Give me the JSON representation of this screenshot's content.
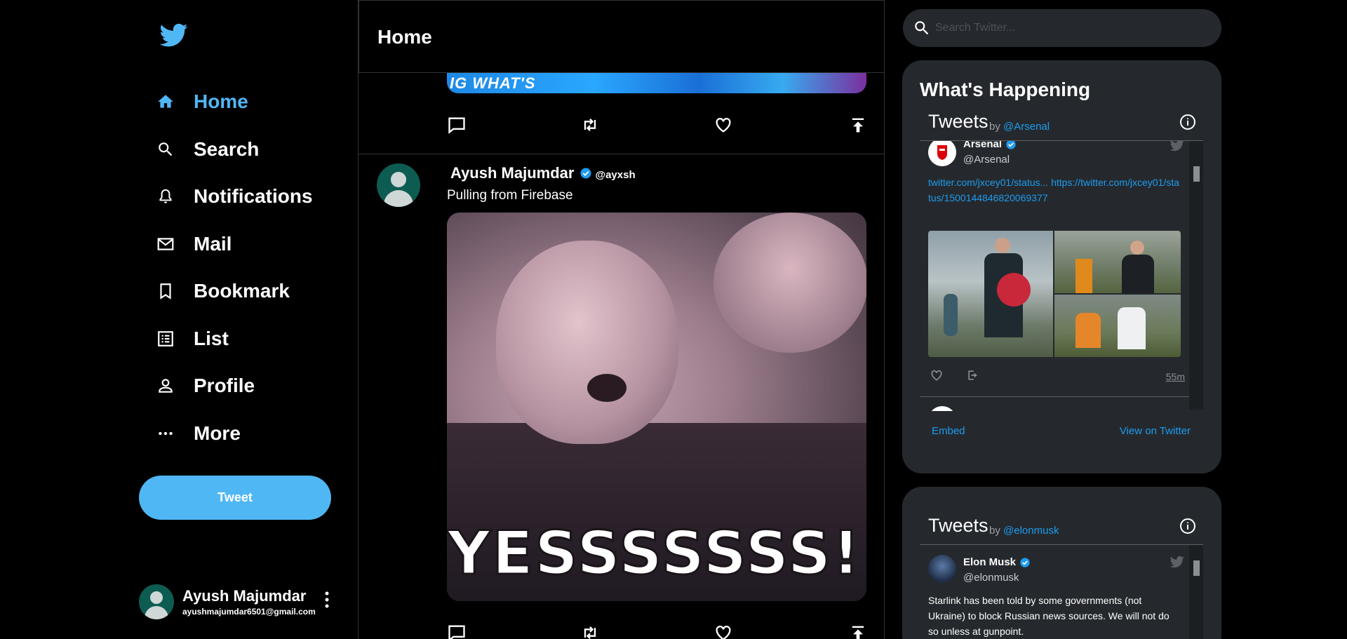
{
  "sidebar": {
    "nav": [
      {
        "label": "Home",
        "icon": "home-icon"
      },
      {
        "label": "Search",
        "icon": "search-icon"
      },
      {
        "label": "Notifications",
        "icon": "bell-icon"
      },
      {
        "label": "Mail",
        "icon": "mail-icon"
      },
      {
        "label": "Bookmark",
        "icon": "bookmark-icon"
      },
      {
        "label": "List",
        "icon": "list-icon"
      },
      {
        "label": "Profile",
        "icon": "person-icon"
      },
      {
        "label": "More",
        "icon": "more-dots-icon"
      }
    ],
    "tweet_button": "Tweet",
    "profile": {
      "name": "Ayush Majumdar",
      "email": "ayushmajumdar6501@gmail.com"
    }
  },
  "feed": {
    "title": "Home",
    "banner_text": "IG WHAT'S",
    "post": {
      "name": "Ayush Majumdar",
      "handle": "@ayxsh",
      "text": "Pulling from Firebase",
      "media_caption": "YESSSSSSS!!"
    }
  },
  "search": {
    "placeholder": "Search Twitter..."
  },
  "right": {
    "happening_title": "What's Happening",
    "widget1": {
      "title": "Tweets",
      "by": "by",
      "account": "@Arsenal",
      "tweet": {
        "name": "Arsenal",
        "handle": "@Arsenal",
        "link1": "twitter.com/jxcey01/status...",
        "link2": "https://twitter.com/jxcey01/status/1500144846820069377",
        "time": "55m"
      },
      "embed": "Embed",
      "view": "View on Twitter"
    },
    "widget2": {
      "title": "Tweets",
      "by": "by",
      "account": "@elonmusk",
      "tweet": {
        "name": "Elon Musk",
        "handle": "@elonmusk",
        "text": "Starlink has been told by some governments (not Ukraine) to block Russian news sources. We will not do so unless at gunpoint."
      }
    }
  },
  "colors": {
    "accent": "#50b7f5",
    "link": "#1d9bf0",
    "card": "#25292d",
    "background": "#000000"
  }
}
